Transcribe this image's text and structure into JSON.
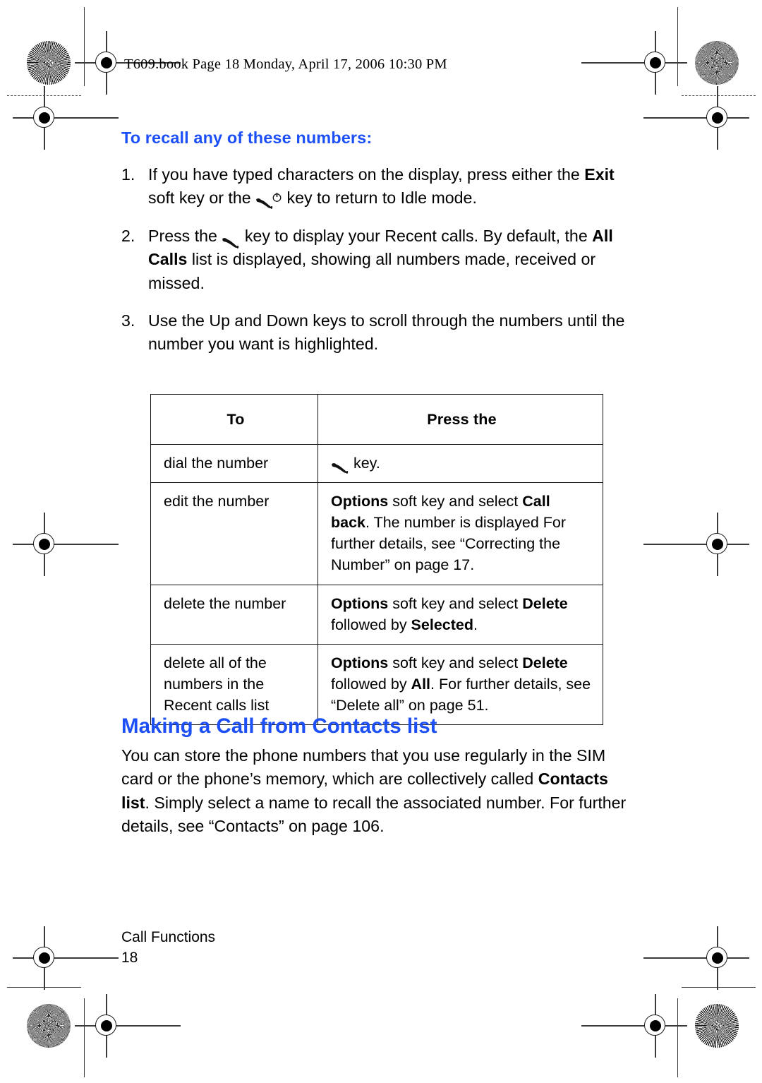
{
  "running_header": "T609.book  Page 18  Monday, April 17, 2006  10:30 PM",
  "accent_color": "#1c4ff5",
  "sub_heading": "To recall any of these numbers:",
  "steps": [
    {
      "number": "1.",
      "parts": [
        {
          "text": "If you have typed characters on the display, press either the ",
          "style": "normal"
        },
        {
          "text": "Exit",
          "style": "bold"
        },
        {
          "text": " soft key or the ",
          "style": "normal"
        },
        {
          "text": "",
          "style": "icon",
          "icon": "end-call-key-icon"
        },
        {
          "text": " key to return to Idle mode.",
          "style": "normal"
        }
      ]
    },
    {
      "number": "2.",
      "parts": [
        {
          "text": "Press the ",
          "style": "normal"
        },
        {
          "text": "",
          "style": "icon",
          "icon": "send-call-key-icon"
        },
        {
          "text": " key to display your Recent calls. By default, the ",
          "style": "normal"
        },
        {
          "text": "All Calls",
          "style": "bold"
        },
        {
          "text": " list is displayed, showing all numbers made, received or missed.",
          "style": "normal"
        }
      ]
    },
    {
      "number": "3.",
      "parts": [
        {
          "text": "Use the Up and Down keys to scroll through the numbers until the number you want is highlighted.",
          "style": "normal"
        }
      ]
    }
  ],
  "table": {
    "headers": [
      "To",
      "Press the"
    ],
    "rows": [
      {
        "to": "dial the number",
        "press_parts": [
          {
            "text": "",
            "style": "icon",
            "icon": "send-call-key-icon"
          },
          {
            "text": " key.",
            "style": "normal"
          }
        ]
      },
      {
        "to": "edit the number",
        "press_parts": [
          {
            "text": "Options",
            "style": "bold"
          },
          {
            "text": " soft key and select ",
            "style": "normal"
          },
          {
            "text": "Call back",
            "style": "bold"
          },
          {
            "text": ". The number is displayed For further details, see “Correcting the Number” on page 17.",
            "style": "normal"
          }
        ]
      },
      {
        "to": "delete the number",
        "press_parts": [
          {
            "text": "Options",
            "style": "bold"
          },
          {
            "text": " soft key and select ",
            "style": "normal"
          },
          {
            "text": "Delete",
            "style": "bold"
          },
          {
            "text": " followed by ",
            "style": "normal"
          },
          {
            "text": "Selected",
            "style": "bold"
          },
          {
            "text": ".",
            "style": "normal"
          }
        ]
      },
      {
        "to": "delete all of the numbers in the Recent calls list",
        "press_parts": [
          {
            "text": "Options",
            "style": "bold"
          },
          {
            "text": " soft key and select ",
            "style": "normal"
          },
          {
            "text": "Delete",
            "style": "bold"
          },
          {
            "text": " followed by ",
            "style": "normal"
          },
          {
            "text": "All",
            "style": "bold"
          },
          {
            "text": ". For further details, see “Delete all” on page 51.",
            "style": "normal"
          }
        ]
      }
    ]
  },
  "section_heading": "Making a Call from Contacts list",
  "section_body_parts": [
    {
      "text": "You can store the phone numbers that you use regularly in the SIM card or the phone’s memory, which are collectively called ",
      "style": "normal"
    },
    {
      "text": "Contacts list",
      "style": "bold"
    },
    {
      "text": ". Simply select a name to recall the associated number. For further details, see “Contacts” on page 106.",
      "style": "normal"
    }
  ],
  "footer": {
    "chapter": "Call Functions",
    "page_number": "18"
  }
}
